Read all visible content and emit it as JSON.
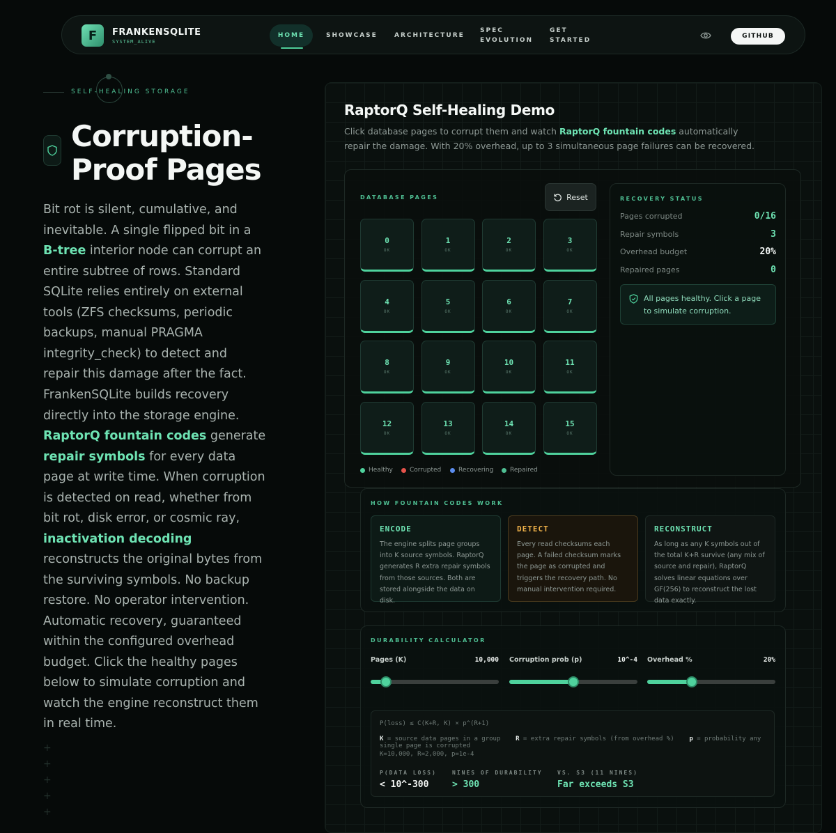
{
  "nav": {
    "brand": "FRANKENSQLITE",
    "brand_sub": "SYSTEM_ALIVE",
    "logo_letter": "F",
    "items": [
      "HOME",
      "SHOWCASE",
      "ARCHITECTURE",
      "SPEC EVOLUTION",
      "GET STARTED"
    ],
    "github": "GITHUB"
  },
  "hero": {
    "eyebrow": "SELF-HEALING STORAGE",
    "title": "Corruption-Proof Pages",
    "p1": [
      {
        "t": "Bit rot is silent, cumulative, and inevitable. A single flipped bit in a "
      },
      {
        "t": "B-tree",
        "hl": true
      },
      {
        "t": " interior node can corrupt an entire subtree of rows. Standard SQLite relies entirely on external tools (ZFS checksums, periodic backups, manual PRAGMA integrity_check) to detect and repair this damage after the fact."
      }
    ],
    "p2": [
      {
        "t": "FrankenSQLite builds recovery directly into the storage engine. "
      },
      {
        "t": "RaptorQ fountain codes",
        "hl": true
      },
      {
        "t": " generate "
      },
      {
        "t": "repair symbols",
        "hl": true
      },
      {
        "t": " for every data page at write time. When corruption is detected on read, whether from bit rot, disk error, or cosmic ray, "
      },
      {
        "t": "inactivation decoding",
        "hl": true
      },
      {
        "t": " reconstructs the original bytes from the surviving symbols. No backup restore. No operator intervention. Automatic recovery, guaranteed within the configured overhead budget. Click the healthy pages below to simulate corruption and watch the engine reconstruct them in real time."
      }
    ]
  },
  "demo": {
    "title": "RaptorQ Self-Healing Demo",
    "desc_before": "Click database pages to corrupt them and watch ",
    "desc_hl": "RaptorQ fountain codes",
    "desc_after": " automatically repair the damage. With 20% overhead, up to 3 simultaneous page failures can be recovered.",
    "pages_label": "DATABASE PAGES",
    "reset": "Reset",
    "pages": [
      {
        "n": "0",
        "s": "OK"
      },
      {
        "n": "1",
        "s": "OK"
      },
      {
        "n": "2",
        "s": "OK"
      },
      {
        "n": "3",
        "s": "OK"
      },
      {
        "n": "4",
        "s": "OK"
      },
      {
        "n": "5",
        "s": "OK"
      },
      {
        "n": "6",
        "s": "OK"
      },
      {
        "n": "7",
        "s": "OK"
      },
      {
        "n": "8",
        "s": "OK"
      },
      {
        "n": "9",
        "s": "OK"
      },
      {
        "n": "10",
        "s": "OK"
      },
      {
        "n": "11",
        "s": "OK"
      },
      {
        "n": "12",
        "s": "OK"
      },
      {
        "n": "13",
        "s": "OK"
      },
      {
        "n": "14",
        "s": "OK"
      },
      {
        "n": "15",
        "s": "OK"
      }
    ],
    "legend": [
      {
        "label": "Healthy",
        "color": "#4fd29d"
      },
      {
        "label": "Corrupted",
        "color": "#e5534b"
      },
      {
        "label": "Recovering",
        "color": "#5b8def"
      },
      {
        "label": "Repaired",
        "color": "#4fbf93"
      }
    ],
    "status": {
      "label": "RECOVERY STATUS",
      "rows": [
        {
          "label": "Pages corrupted",
          "value": "0/16",
          "color": "#6ee3b3"
        },
        {
          "label": "Repair symbols",
          "value": "3",
          "color": "#6ee3b3"
        },
        {
          "label": "Overhead budget",
          "value": "20%",
          "color": "#f1f5f3"
        },
        {
          "label": "Repaired pages",
          "value": "0",
          "color": "#6ee3b3"
        }
      ],
      "message": "All pages healthy. Click a page to simulate corruption."
    },
    "fountain": {
      "label": "HOW FOUNTAIN CODES WORK",
      "cards": [
        {
          "title": "ENCODE",
          "body": "The engine splits page groups into K source symbols. RaptorQ generates R extra repair symbols from those sources. Both are stored alongside the data on disk.",
          "accent": "#6ee3b3",
          "border": "#1f3a32",
          "bg": "#0d1a16"
        },
        {
          "title": "DETECT",
          "body": "Every read checksums each page. A failed checksum marks the page as corrupted and triggers the recovery path. No manual intervention required.",
          "accent": "#f0b24a",
          "border": "#4a3a1d",
          "bg": "#1a150c"
        },
        {
          "title": "RECONSTRUCT",
          "body": "As long as any K symbols out of the total K+R survive (any mix of source and repair), RaptorQ solves linear equations over GF(256) to reconstruct the lost data exactly.",
          "accent": "#6ee3b3",
          "border": "#1d2824",
          "bg": "#0f1513"
        }
      ]
    },
    "calc": {
      "label": "DURABILITY CALCULATOR",
      "sliders": [
        {
          "label": "Pages (K)",
          "value": "10,000",
          "fraction": 0.12
        },
        {
          "label": "Corruption prob (p)",
          "value": "10^-4",
          "fraction": 0.5
        },
        {
          "label": "Overhead %",
          "value": "20%",
          "fraction": 0.35
        }
      ],
      "formula": "P(loss) ≤ C(K+R, K) × p^(R+1)",
      "legend": [
        {
          "k": "K",
          "d": " = source data pages in a group"
        },
        {
          "k": "R",
          "d": " = extra repair symbols (from overhead %)"
        },
        {
          "k": "p",
          "d": " = probability any single page is corrupted"
        }
      ],
      "params": "K=10,000, R=2,000, p=1e-4",
      "results": [
        {
          "label": "P(DATA LOSS)",
          "value": "< 10^-300",
          "color": "#f4f7f5"
        },
        {
          "label": "NINES OF DURABILITY",
          "value": "> 300",
          "color": "#6ee3b3"
        },
        {
          "label": "VS. S3 (11 NINES)",
          "value": "Far exceeds S3",
          "color": "#6ee3b3"
        }
      ]
    }
  }
}
